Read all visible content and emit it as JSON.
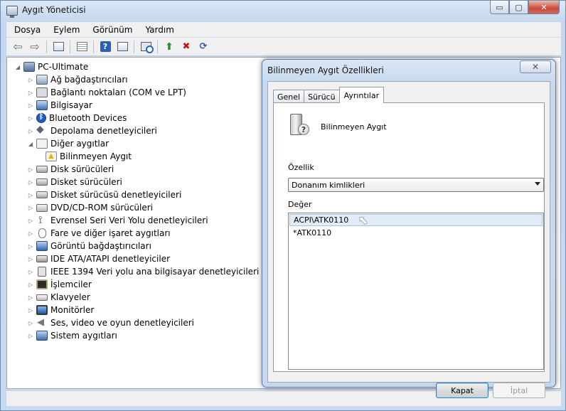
{
  "window": {
    "title": "Aygıt Yöneticisi",
    "caption_buttons": {
      "minimize": "▭",
      "maximize": "▢",
      "close": "✕"
    }
  },
  "menu": [
    "Dosya",
    "Eylem",
    "Görünüm",
    "Yardım"
  ],
  "toolbar": {
    "buttons": [
      "back-icon",
      "forward-icon",
      "show-hide-console-tree-icon",
      "properties-icon",
      "help-icon",
      "scan-hardware-icon",
      "update-driver-icon",
      "uninstall-icon",
      "disable-icon"
    ],
    "back_glyph": "⇦",
    "forward_glyph": "⇨",
    "help_glyph": "?",
    "up_glyph": "⬆",
    "x_glyph": "✖",
    "dl_glyph": "⟳"
  },
  "tree": {
    "root": "PC-Ultimate",
    "expanders": {
      "expanded": "◢",
      "collapsed": "▷"
    },
    "categories": [
      {
        "label": "Ağ bağdaştırıcıları",
        "icon": "network-adapter-icon"
      },
      {
        "label": "Bağlantı noktaları (COM ve LPT)",
        "icon": "ports-icon"
      },
      {
        "label": "Bilgisayar",
        "icon": "computer-icon"
      },
      {
        "label": "Bluetooth Devices",
        "icon": "bluetooth-icon"
      },
      {
        "label": "Depolama denetleyicileri",
        "icon": "storage-controller-icon"
      },
      {
        "label": "Diğer aygıtlar",
        "icon": "other-devices-icon",
        "expanded": true,
        "children": [
          {
            "label": "Bilinmeyen Aygıt",
            "icon": "unknown-device-warning-icon"
          }
        ]
      },
      {
        "label": "Disk sürücüleri",
        "icon": "disk-drive-icon"
      },
      {
        "label": "Disket sürücüleri",
        "icon": "floppy-drive-icon"
      },
      {
        "label": "Disket sürücüsü denetleyicileri",
        "icon": "floppy-controller-icon"
      },
      {
        "label": "DVD/CD-ROM sürücüleri",
        "icon": "dvd-drive-icon"
      },
      {
        "label": "Evrensel Seri Veri Yolu denetleyicileri",
        "icon": "usb-icon"
      },
      {
        "label": "Fare ve diğer işaret aygıtları",
        "icon": "mouse-icon"
      },
      {
        "label": "Görüntü bağdaştırıcıları",
        "icon": "display-adapter-icon"
      },
      {
        "label": "IDE ATA/ATAPI denetleyiciler",
        "icon": "ide-controller-icon"
      },
      {
        "label": "IEEE 1394 Veri yolu ana bilgisayar denetleyicileri",
        "icon": "ieee1394-icon"
      },
      {
        "label": "İşlemciler",
        "icon": "processor-icon"
      },
      {
        "label": "Klavyeler",
        "icon": "keyboard-icon"
      },
      {
        "label": "Monitörler",
        "icon": "monitor-icon"
      },
      {
        "label": "Ses, video ve oyun denetleyicileri",
        "icon": "sound-icon"
      },
      {
        "label": "Sistem aygıtları",
        "icon": "system-devices-icon"
      }
    ]
  },
  "dialog": {
    "title": "Bilinmeyen Aygıt Özellikleri",
    "close_glyph": "✕",
    "tabs": [
      "Genel",
      "Sürücü",
      "Ayrıntılar"
    ],
    "active_tab": "Ayrıntılar",
    "device_name": "Bilinmeyen Aygıt",
    "device_icon_glyph": "?",
    "property_label": "Özellik",
    "property_value": "Donanım kimlikleri",
    "value_label": "Değer",
    "values": [
      "ACPI\\ATK0110",
      "*ATK0110"
    ],
    "selected_value_index": 0,
    "ok_button": "Kapat",
    "cancel_button": "İptal"
  }
}
